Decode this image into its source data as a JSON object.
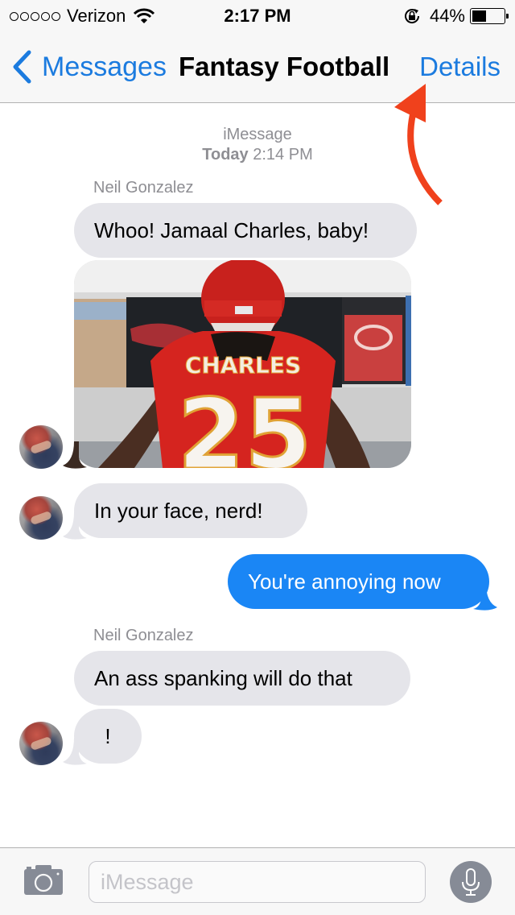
{
  "status_bar": {
    "carrier": "Verizon",
    "signal_bars_filled": 0,
    "signal_bars_total": 5,
    "time": "2:17 PM",
    "battery_percent": "44%",
    "battery_level": 0.44
  },
  "nav": {
    "back_label": "Messages",
    "title": "Fantasy Football",
    "details_label": "Details"
  },
  "conversation": {
    "service": "iMessage",
    "date_prefix": "Today",
    "date_time": "2:14 PM",
    "messages": [
      {
        "sender": "Neil Gonzalez",
        "direction": "incoming",
        "text": "Whoo! Jamaal Charles, baby!"
      },
      {
        "sender": "Neil Gonzalez",
        "direction": "incoming",
        "type": "image",
        "image_desc": "Chiefs player #25 CHARLES photo",
        "jersey_name": "CHARLES",
        "jersey_number": "25"
      },
      {
        "sender": "Neil Gonzalez",
        "direction": "incoming",
        "text": "In your face, nerd!"
      },
      {
        "sender": "me",
        "direction": "outgoing",
        "text": "You're annoying now"
      },
      {
        "sender": "Neil Gonzalez",
        "direction": "incoming",
        "text": "An ass spanking will do that"
      },
      {
        "sender": "Neil Gonzalez",
        "direction": "incoming",
        "text": "!"
      }
    ]
  },
  "input_bar": {
    "placeholder": "iMessage",
    "value": ""
  },
  "colors": {
    "accent": "#1b7bdf",
    "outgoing_bubble": "#1a86f5",
    "incoming_bubble": "#e5e5ea",
    "annotation_arrow": "#f0411c"
  }
}
